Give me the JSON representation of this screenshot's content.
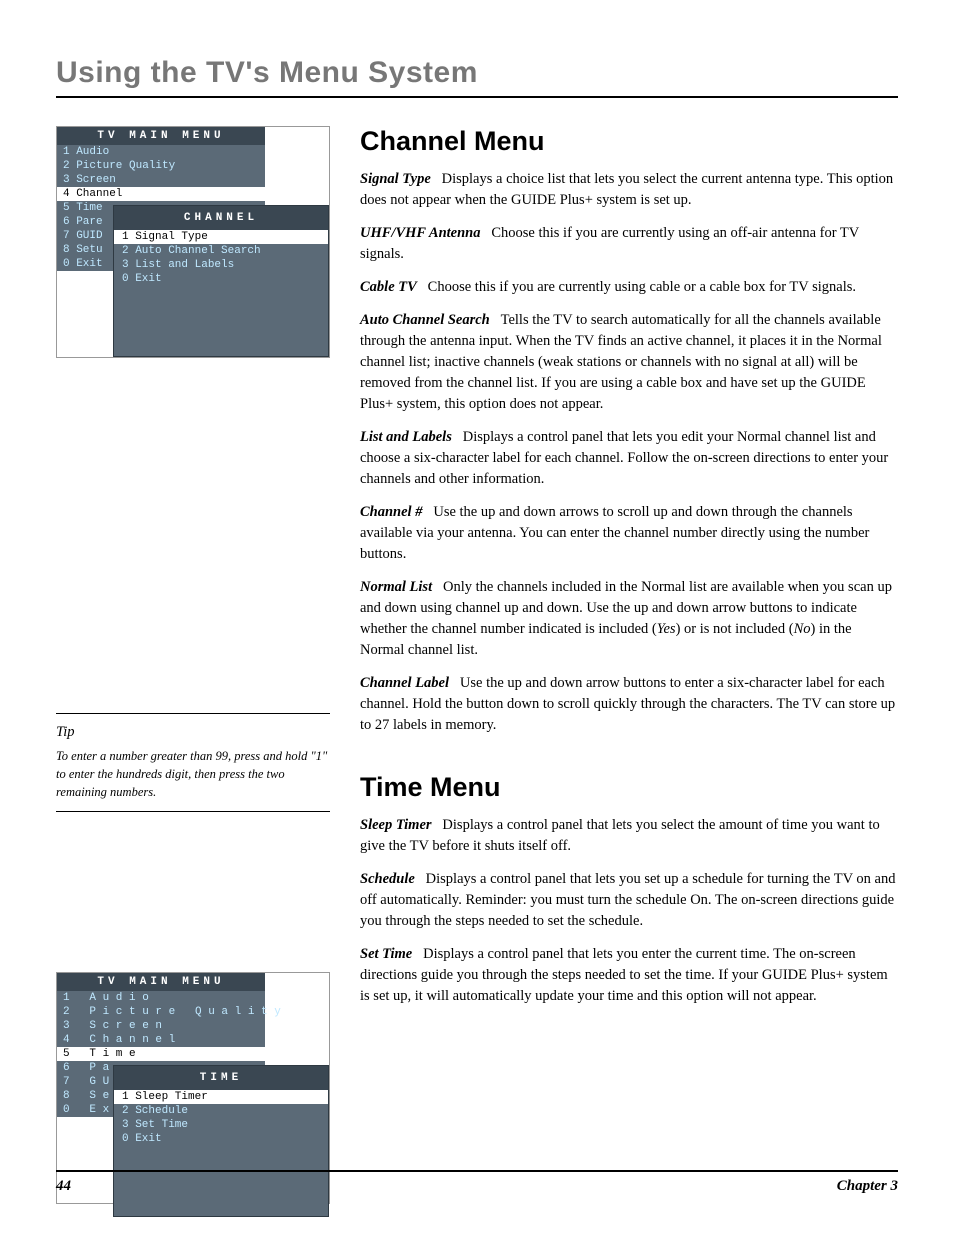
{
  "masterHead": "Using the TV's Menu System",
  "section1": {
    "title": "Channel Menu",
    "p1_term": "Signal Type",
    "p1_text": "   Displays a choice list that lets you select the current antenna type. This option does not appear when the GUIDE Plus+ system is set up.",
    "p1a_term": "UHF/VHF Antenna",
    "p1a_text": "   Choose this if you are currently using an off-air antenna for TV signals.",
    "p1b_term": "Cable TV",
    "p1b_text": "   Choose this if you are currently using cable or a cable box for TV signals.",
    "p2_term": "Auto Channel Search",
    "p2_text": "   Tells the TV to search automatically for all the channels available through the antenna input. When the TV finds an active channel, it places it in the Normal channel list; inactive channels (weak stations or channels with no signal at all) will be removed from the channel list. If you are using a cable box and have set up the GUIDE Plus+ system, this option does not appear.",
    "p3_term": "List and Labels",
    "p3_text": "   Displays a control panel that lets you edit your Normal channel list and choose a six-character label for each channel. Follow the on-screen directions to enter your channels and other information.",
    "p3a_term": "Channel #",
    "p3a_text": "   Use the up and down arrows to scroll up and down through the channels available via your antenna. You can enter the channel number directly using the number buttons.",
    "p3b_term": "Normal List",
    "p3b_text": "   Only the channels included in the Normal list are available when you scan up and down using channel up and down. Use the up and down arrow buttons to indicate whether the channel number indicated is included (",
    "p3b_yes": "Yes",
    "p3b_mid": ") or is not included (",
    "p3b_no": "No",
    "p3b_end": ") in the Normal channel list.",
    "p3c_term": "Channel Label",
    "p3c_text": "   Use the up and down arrow buttons to enter a six-character label for each channel. Hold the button down to scroll quickly through the characters. The TV can store up to 27 labels in memory."
  },
  "tip": {
    "title": "Tip",
    "text": "To enter a number greater than 99, press and hold \"1\" to enter the hundreds digit, then press the two remaining numbers."
  },
  "section2": {
    "title": "Time Menu",
    "p1_term": "Sleep Timer",
    "p1_text": "   Displays a control panel that lets you select the amount of time you want to give the TV before it shuts itself off.",
    "p2_term": "Schedule",
    "p2_text": "   Displays a control panel that lets you set up a schedule for turning the TV on and off automatically. Reminder: you must turn the schedule On. The on-screen directions guide you through the steps needed to set the schedule.",
    "p3_term": "Set Time",
    "p3_text": "   Displays a control panel that lets you enter the current time. The on-screen directions guide you through the steps needed to set the time. If your GUIDE Plus+ system is set up, it will automatically update your time and this option will not appear."
  },
  "tvMenu1": {
    "title": "TV MAIN MENU",
    "items": [
      "1 Audio",
      "2 Picture Quality",
      "3 Screen",
      "4 Channel",
      "5 Time",
      "6 Pare",
      "7 GUID",
      "8 Setu",
      "0 Exit"
    ],
    "selectedIndex": 3,
    "subTitle": "CHANNEL",
    "subItems": [
      "1 Signal Type",
      "2 Auto Channel Search",
      "3 List and Labels",
      "0 Exit"
    ],
    "subSelectedIndex": 0
  },
  "tvMenu2": {
    "title": "TV MAIN MENU",
    "items": [
      "1 Audio",
      "2 Picture Quality",
      "3 Screen",
      "4 Channel",
      "5 Time",
      "6 Pa",
      "7 GU",
      "8 Se",
      "0 Ex"
    ],
    "selectedIndex": 4,
    "subTitle": "TIME",
    "subItems": [
      "1 Sleep Timer",
      "2 Schedule",
      "3 Set Time",
      "0 Exit"
    ],
    "subSelectedIndex": 0
  },
  "footer": {
    "pageNum": "44",
    "chapter": "Chapter 3"
  }
}
